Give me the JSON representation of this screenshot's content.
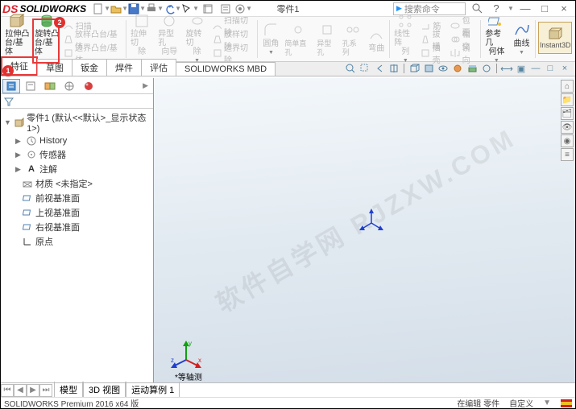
{
  "titlebar": {
    "logo_ds": "DS",
    "logo_text": "SOLIDWORKS",
    "doc_title": "零件1",
    "search_placeholder": "搜索命令",
    "help_q": "?"
  },
  "ribbon": {
    "extrude": {
      "l1": "拉伸凸",
      "l2": "台/基体"
    },
    "revolve": {
      "l1": "旋转凸",
      "l2": "台/基体"
    },
    "sweep": "扫描",
    "loft": "放样凸台/基体",
    "boundary": "边界凸台/基体",
    "extrude_cut": {
      "l1": "拉伸切",
      "l2": "除"
    },
    "hole": {
      "l1": "异型孔",
      "l2": "向导"
    },
    "revolve_cut": {
      "l1": "旋转切",
      "l2": "除"
    },
    "sweep_cut": "扫描切除",
    "loft_cut": "放样切除",
    "boundary_cut": "边界切除",
    "fillet": "圆角",
    "pattern": {
      "l1": "线性阵",
      "l2": "列"
    },
    "rib": "筋",
    "draft": "拔模",
    "shell": "抽壳",
    "wrap": "包覆",
    "intersect": "相交",
    "mirror": "镜向",
    "simple_hole": "简单直孔",
    "shaped_hole": "异型孔",
    "hole_series": "孔系列",
    "bend": "弯曲",
    "ref_geom": {
      "l1": "参考几",
      "l2": "何体"
    },
    "curves": "曲线",
    "instant3d": "Instant3D"
  },
  "feature_tabs": [
    "特征",
    "草图",
    "钣金",
    "焊件",
    "评估",
    "SOLIDWORKS MBD"
  ],
  "tree": {
    "root": "零件1 (默认<<默认>_显示状态 1>)",
    "history": "History",
    "sensors": "传感器",
    "annotations": "注解",
    "material": "材质 <未指定>",
    "front": "前视基准面",
    "top": "上视基准面",
    "right": "右视基准面",
    "origin": "原点"
  },
  "orient_label": "*等轴测",
  "bottom_tabs": [
    "模型",
    "3D 视图",
    "运动算例 1"
  ],
  "status": {
    "left": "SOLIDWORKS Premium 2016 x64 版",
    "editing": "在编辑 零件",
    "custom": "自定义"
  },
  "watermark": "软件自学网 RJZXW.COM",
  "markers": {
    "red1": "1",
    "red2": "2"
  }
}
